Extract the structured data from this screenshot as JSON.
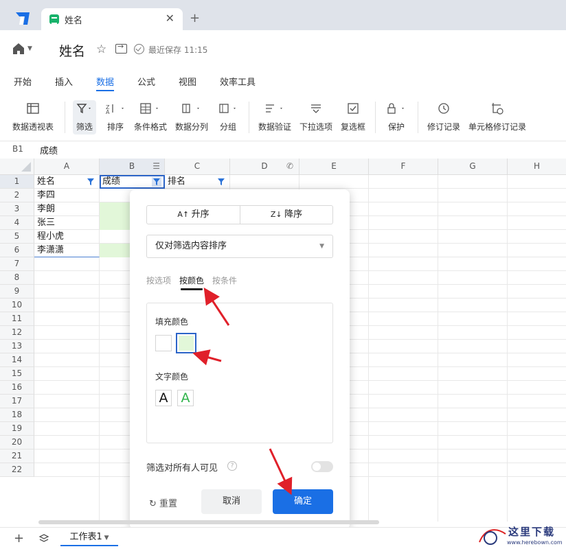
{
  "tab": {
    "title": "姓名"
  },
  "header": {
    "doc_title": "姓名",
    "saved_status": "最近保存 11:15"
  },
  "menu": [
    "开始",
    "插入",
    "数据",
    "公式",
    "视图",
    "效率工具"
  ],
  "toolbar": {
    "pivot": "数据透视表",
    "filter": "筛选",
    "sort": "排序",
    "cond_format": "条件格式",
    "split": "数据分列",
    "group": "分组",
    "validation": "数据验证",
    "dropdown": "下拉选项",
    "checkbox": "复选框",
    "protect": "保护",
    "revision": "修订记录",
    "cell_revision": "单元格修订记录"
  },
  "formula_bar": {
    "cell_ref": "B1",
    "value": "成绩"
  },
  "columns": [
    "A",
    "B",
    "C",
    "D",
    "E",
    "F",
    "G",
    "H"
  ],
  "rows": [
    "1",
    "2",
    "3",
    "4",
    "5",
    "6",
    "7",
    "8",
    "9",
    "10",
    "11",
    "12",
    "13",
    "14",
    "15",
    "16",
    "17",
    "18",
    "19",
    "20",
    "21",
    "22"
  ],
  "cells": {
    "A": [
      "姓名",
      "李四",
      "李朗",
      "张三",
      "程小虎",
      "李潇潇"
    ],
    "B1": "成绩",
    "C1": "排名"
  },
  "filter_popup": {
    "sort_asc": "升序",
    "sort_desc": "降序",
    "sort_scope": "仅对筛选内容排序",
    "tabs": [
      "按选项",
      "按颜色",
      "按条件"
    ],
    "fill_color_label": "填充颜色",
    "text_color_label": "文字颜色",
    "text_color_glyph": "A",
    "visible_label": "筛选对所有人可见",
    "help": "?",
    "reset": "重置",
    "cancel": "取消",
    "ok": "确定",
    "colors": {
      "fill_green": "#e2f7d9",
      "text_green": "#2fb34a",
      "primary": "#1a6fe5"
    }
  },
  "sheet_bar": {
    "sheet_name": "工作表1"
  },
  "watermark": {
    "text": "这里下载",
    "url": "www.herebown.com"
  }
}
